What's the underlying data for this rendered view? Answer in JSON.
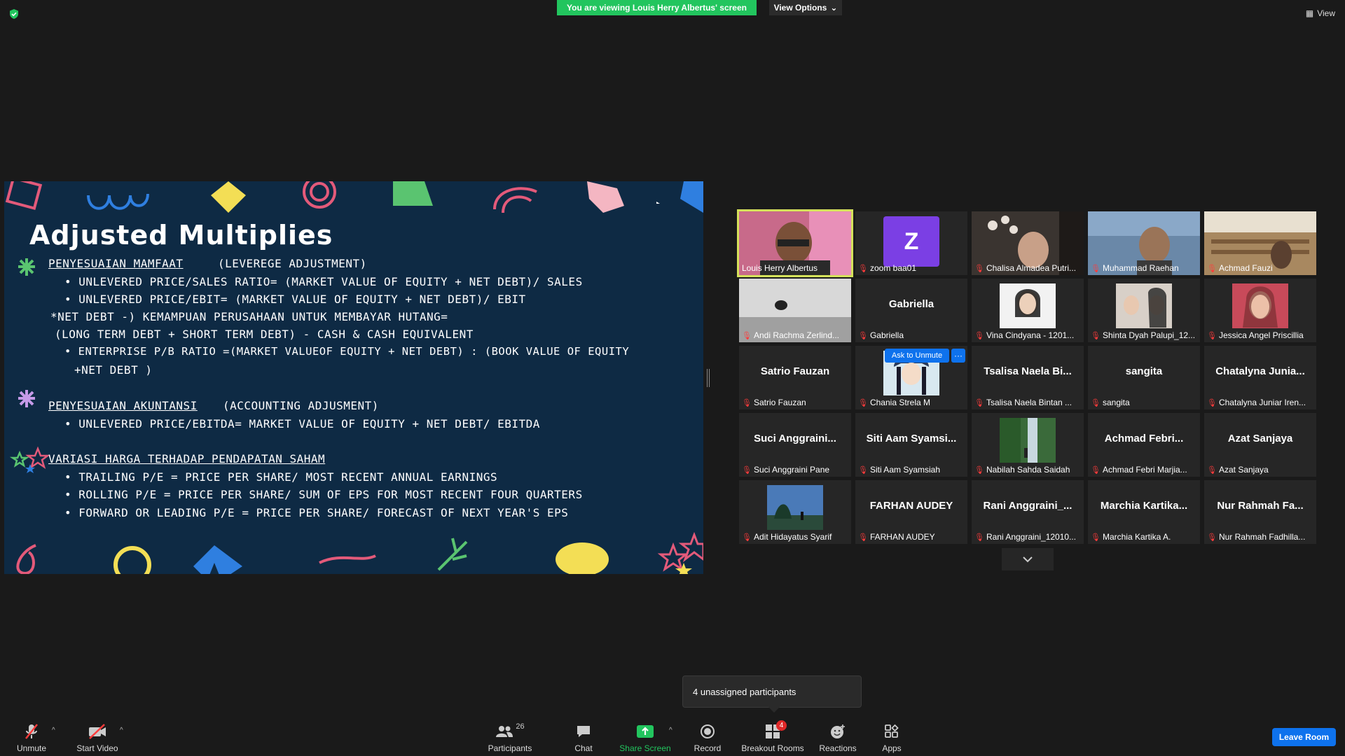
{
  "top": {
    "viewing_banner": "You are viewing Louis Herry Albertus' screen",
    "view_options": "View Options",
    "view": "View"
  },
  "slide": {
    "title": "Adjusted Multiplies",
    "lines": [
      "PENYESUAIAN MAMFAAT",
      "(LEVEREGE ADJUSTMENT)",
      "• UNLEVERED PRICE/SALES RATIO= (MARKET VALUE OF EQUITY + NET DEBT)/ SALES",
      "• UNLEVERED PRICE/EBIT= (MARKET VALUE OF EQUITY + NET DEBT)/ EBIT",
      "*NET DEBT -) KEMAMPUAN PERUSAHAAN UNTUK MEMBAYAR HUTANG=",
      "(LONG TERM DEBT + SHORT TERM DEBT) - CASH & CASH EQUIVALENT",
      "• ENTERPRISE P/B RATIO =(MARKET VALUEOF EQUITY + NET DEBT) : (BOOK VALUE OF EQUITY",
      "+NET DEBT )",
      "PENYESUAIAN AKUNTANSI",
      "(ACCOUNTING ADJUSMENT)",
      "• UNLEVERED PRICE/EBITDA= MARKET VALUE OF EQUITY + NET DEBT/ EBITDA",
      "VARIASI HARGA TERHADAP PENDAPATAN SAHAM",
      "• TRAILING P/E = PRICE PER SHARE/ MOST RECENT ANNUAL EARNINGS",
      "• ROLLING P/E = PRICE PER SHARE/ SUM OF EPS FOR MOST RECENT FOUR QUARTERS",
      "• FORWARD OR LEADING P/E = PRICE PER SHARE/ FORECAST OF NEXT YEAR'S EPS"
    ]
  },
  "gallery": {
    "tiles": [
      {
        "label": "Louis Herry Albertus",
        "big": ""
      },
      {
        "label": "zoom baa01",
        "big": "Z"
      },
      {
        "label": "Chalisa Almadea Putri...",
        "big": ""
      },
      {
        "label": "Muhammad Raehan",
        "big": ""
      },
      {
        "label": "Achmad Fauzi",
        "big": ""
      },
      {
        "label": "Andi Rachma Zerlind...",
        "big": ""
      },
      {
        "label": "Gabriella",
        "big": "Gabriella"
      },
      {
        "label": "Vina Cindyana - 1201...",
        "big": ""
      },
      {
        "label": "Shinta Dyah Palupi_12...",
        "big": ""
      },
      {
        "label": "Jessica Angel Priscillia",
        "big": ""
      },
      {
        "label": "Satrio Fauzan",
        "big": "Satrio Fauzan"
      },
      {
        "label": "Chania Strela M",
        "big": ""
      },
      {
        "label": "Tsalisa Naela Bintan ...",
        "big": "Tsalisa Naela Bi..."
      },
      {
        "label": "sangita",
        "big": "sangita"
      },
      {
        "label": "Chatalyna Juniar Iren...",
        "big": "Chatalyna Junia..."
      },
      {
        "label": "Suci Anggraini Pane",
        "big": "Suci Anggraini..."
      },
      {
        "label": "Siti Aam Syamsiah",
        "big": "Siti Aam Syamsi..."
      },
      {
        "label": "Nabilah Sahda Saidah",
        "big": ""
      },
      {
        "label": "Achmad Febri Marjia...",
        "big": "Achmad Febri..."
      },
      {
        "label": "Azat Sanjaya",
        "big": "Azat Sanjaya"
      },
      {
        "label": "Adit Hidayatus Syarif",
        "big": ""
      },
      {
        "label": "FARHAN AUDEY",
        "big": "FARHAN AUDEY"
      },
      {
        "label": "Rani Anggraini_12010...",
        "big": "Rani Anggraini_..."
      },
      {
        "label": "Marchia Kartika A.",
        "big": "Marchia Kartika..."
      },
      {
        "label": "Nur Rahmah Fadhilla...",
        "big": "Nur Rahmah Fa..."
      }
    ],
    "ask_to_unmute": "Ask to Unmute",
    "more": "···"
  },
  "tooltip": "4 unassigned participants",
  "toolbar": {
    "unmute": "Unmute",
    "start_video": "Start Video",
    "participants": "Participants",
    "participants_count": "26",
    "chat": "Chat",
    "share_screen": "Share Screen",
    "record": "Record",
    "breakout_rooms": "Breakout Rooms",
    "breakout_badge": "4",
    "reactions": "Reactions",
    "apps": "Apps",
    "leave_room": "Leave Room"
  },
  "colors": {
    "accent_green": "#22c55e",
    "accent_blue": "#0e72ed",
    "active_speaker": "#d4e15a",
    "muted_red": "#ff3b3b",
    "slide_bg": "#0e2a44"
  }
}
